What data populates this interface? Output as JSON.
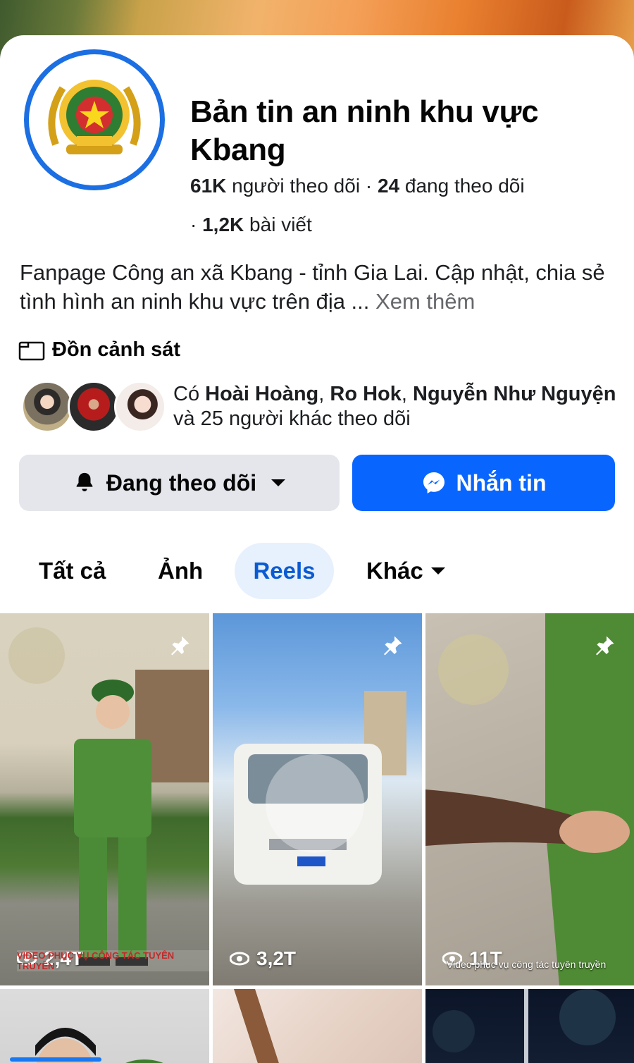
{
  "page": {
    "name": "Bản tin an ninh khu vực Kbang",
    "followers_count": "61K",
    "followers_label": "người theo dõi",
    "following_count": "24",
    "following_label": "đang theo dõi",
    "posts_count": "1,2K",
    "posts_label": "bài viết",
    "bio": "Fanpage Công an xã Kbang - tỉnh Gia Lai. Cập nhật, chia sẻ tình hình an ninh khu vực trên địa ...",
    "see_more": "Xem thêm",
    "category": "Đồn cảnh sát"
  },
  "mutual": {
    "prefix": "Có",
    "names": [
      "Hoài Hoàng",
      "Ro Hok",
      "Nguyễn Như Nguyện"
    ],
    "suffix": "và 25 người khác theo dõi"
  },
  "actions": {
    "follow_label": "Đang theo dõi",
    "message_label": "Nhắn tin"
  },
  "tabs": [
    {
      "label": "Tất cả",
      "active": false
    },
    {
      "label": "Ảnh",
      "active": false
    },
    {
      "label": "Reels",
      "active": true
    },
    {
      "label": "Khác",
      "active": false
    }
  ],
  "reels": [
    {
      "views": "2,4T",
      "caption": "VIDEO PHỤC VỤ CÔNG TÁC TUYÊN TRUYỀN",
      "pinned": true
    },
    {
      "views": "3,2T",
      "caption": "",
      "pinned": true
    },
    {
      "views": "11T",
      "caption": "Video phục vụ công tác tuyên truyền",
      "pinned": true
    }
  ],
  "colors": {
    "accent": "#0866ff",
    "tab_active_bg": "#e7f0fd",
    "tab_active_text": "#0a5bd3",
    "button_gray": "#e4e6eb",
    "muted": "#65676b"
  }
}
